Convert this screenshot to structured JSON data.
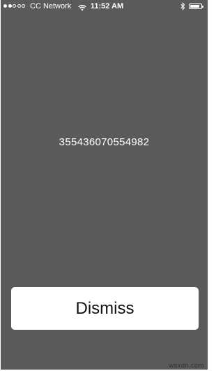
{
  "status_bar": {
    "signal_bars_filled": 2,
    "signal_bars_total": 5,
    "carrier": "CC Network",
    "time": "11:52 AM",
    "battery_level": 0.85,
    "icons": [
      "wifi-icon",
      "bluetooth-icon",
      "battery-icon"
    ]
  },
  "main": {
    "imei": "355436070554982"
  },
  "dismiss_label": "Dismiss",
  "watermark": "wsxdn.com",
  "colors": {
    "background": "#5a5a5a",
    "button": "#ffffff",
    "text": "#ffffff"
  }
}
